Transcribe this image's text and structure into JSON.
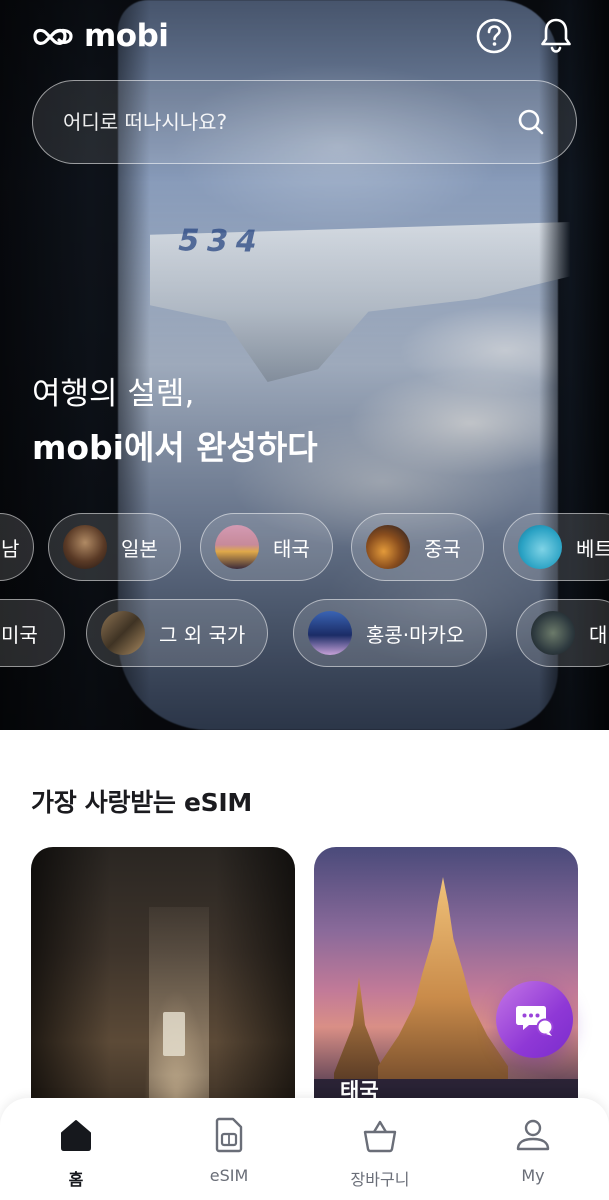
{
  "app": {
    "logo_text": "mobi"
  },
  "search": {
    "placeholder": "어디로 떠나시나요?"
  },
  "hero": {
    "headline_line1": "여행의 설렘,",
    "headline_line2": "mobi에서 완성하다",
    "wing_number": "534"
  },
  "chips_row1": [
    {
      "label": "일본",
      "icon": "japan-photo"
    },
    {
      "label": "태국",
      "icon": "thailand-photo"
    },
    {
      "label": "중국",
      "icon": "china-photo"
    },
    {
      "label": "베트",
      "icon": "vietnam-photo"
    }
  ],
  "chips_row1_partial_left": {
    "label": "남"
  },
  "chips_row2": [
    {
      "label": "그 외 국가",
      "icon": "other-countries-photo"
    },
    {
      "label": "홍콩·마카오",
      "icon": "hongkong-photo"
    },
    {
      "label": "대",
      "icon": "taiwan-photo"
    }
  ],
  "chips_row2_partial_left": {
    "label": "미국"
  },
  "section": {
    "title": "가장 사랑받는 eSIM"
  },
  "cards": [
    {
      "label": "",
      "image": "japan-alley-photo"
    },
    {
      "label": "태국",
      "image": "thailand-temple-photo"
    }
  ],
  "chat": {
    "icon": "chat-bubbles-icon"
  },
  "nav": [
    {
      "label": "홈",
      "icon": "home-icon",
      "active": true
    },
    {
      "label": "eSIM",
      "icon": "sim-card-icon",
      "active": false
    },
    {
      "label": "장바구니",
      "icon": "basket-icon",
      "active": false
    },
    {
      "label": "My",
      "icon": "user-icon",
      "active": false
    }
  ],
  "colors": {
    "accent_purple": "#8f38d6",
    "text_dark": "#1b1b1f",
    "nav_inactive": "#6a6e78"
  }
}
